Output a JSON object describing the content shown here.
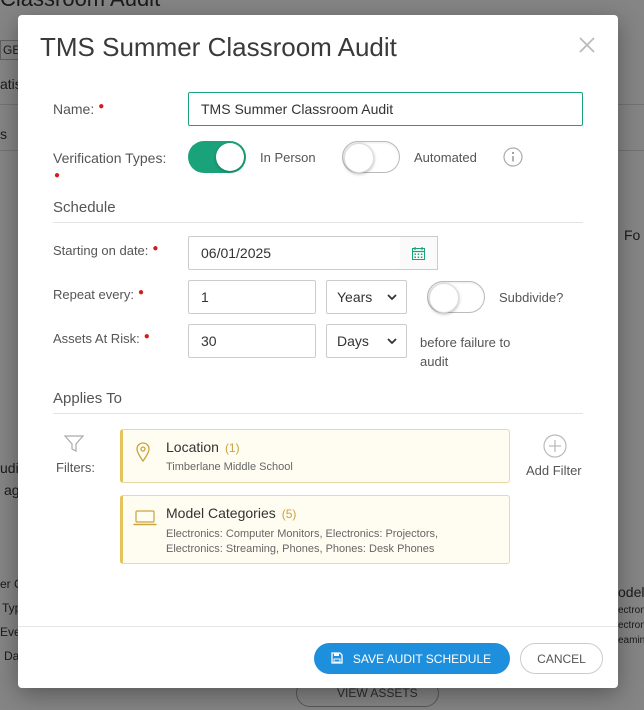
{
  "background": {
    "fragments": [
      "Classroom Audit",
      "GE",
      "atis",
      "s",
      "Fo",
      "udi",
      "ag",
      "er C",
      "Typ",
      "Eve",
      "Da",
      "odel",
      "ectroni",
      "ectroni",
      "eamin"
    ],
    "view_assets_label": "VIEW ASSETS"
  },
  "modal": {
    "title": "TMS Summer Classroom Audit",
    "name_label": "Name:",
    "name_value": "TMS Summer Classroom Audit",
    "verification_label": "Verification Types:",
    "in_person_label": "In Person",
    "in_person_enabled": true,
    "automated_label": "Automated",
    "automated_enabled": false,
    "schedule_heading": "Schedule",
    "start_date_label": "Starting on date:",
    "start_date_value": "06/01/2025",
    "repeat_label": "Repeat every:",
    "repeat_value": "1",
    "repeat_unit": "Years",
    "subdivide_label": "Subdivide?",
    "subdivide_enabled": false,
    "assets_at_risk_label": "Assets At Risk:",
    "assets_at_risk_value": "30",
    "assets_at_risk_unit": "Days",
    "before_failure_text": "before failure to audit",
    "applies_to_heading": "Applies To",
    "filters_label": "Filters:",
    "add_filter_label": "Add Filter",
    "filters": [
      {
        "title": "Location",
        "count": "(1)",
        "description": "Timberlane Middle School",
        "icon": "map-pin-icon"
      },
      {
        "title": "Model Categories",
        "count": "(5)",
        "description": "Electronics: Computer Monitors, Electronics: Projectors, Electronics: Streaming, Phones, Phones: Desk Phones",
        "icon": "laptop-icon"
      }
    ],
    "save_label": "SAVE AUDIT SCHEDULE",
    "cancel_label": "CANCEL"
  },
  "colors": {
    "accent_green": "#1aa37a",
    "primary_blue": "#1e8fdd",
    "required_red": "#d21d1d",
    "card_border": "#e5c45c"
  }
}
